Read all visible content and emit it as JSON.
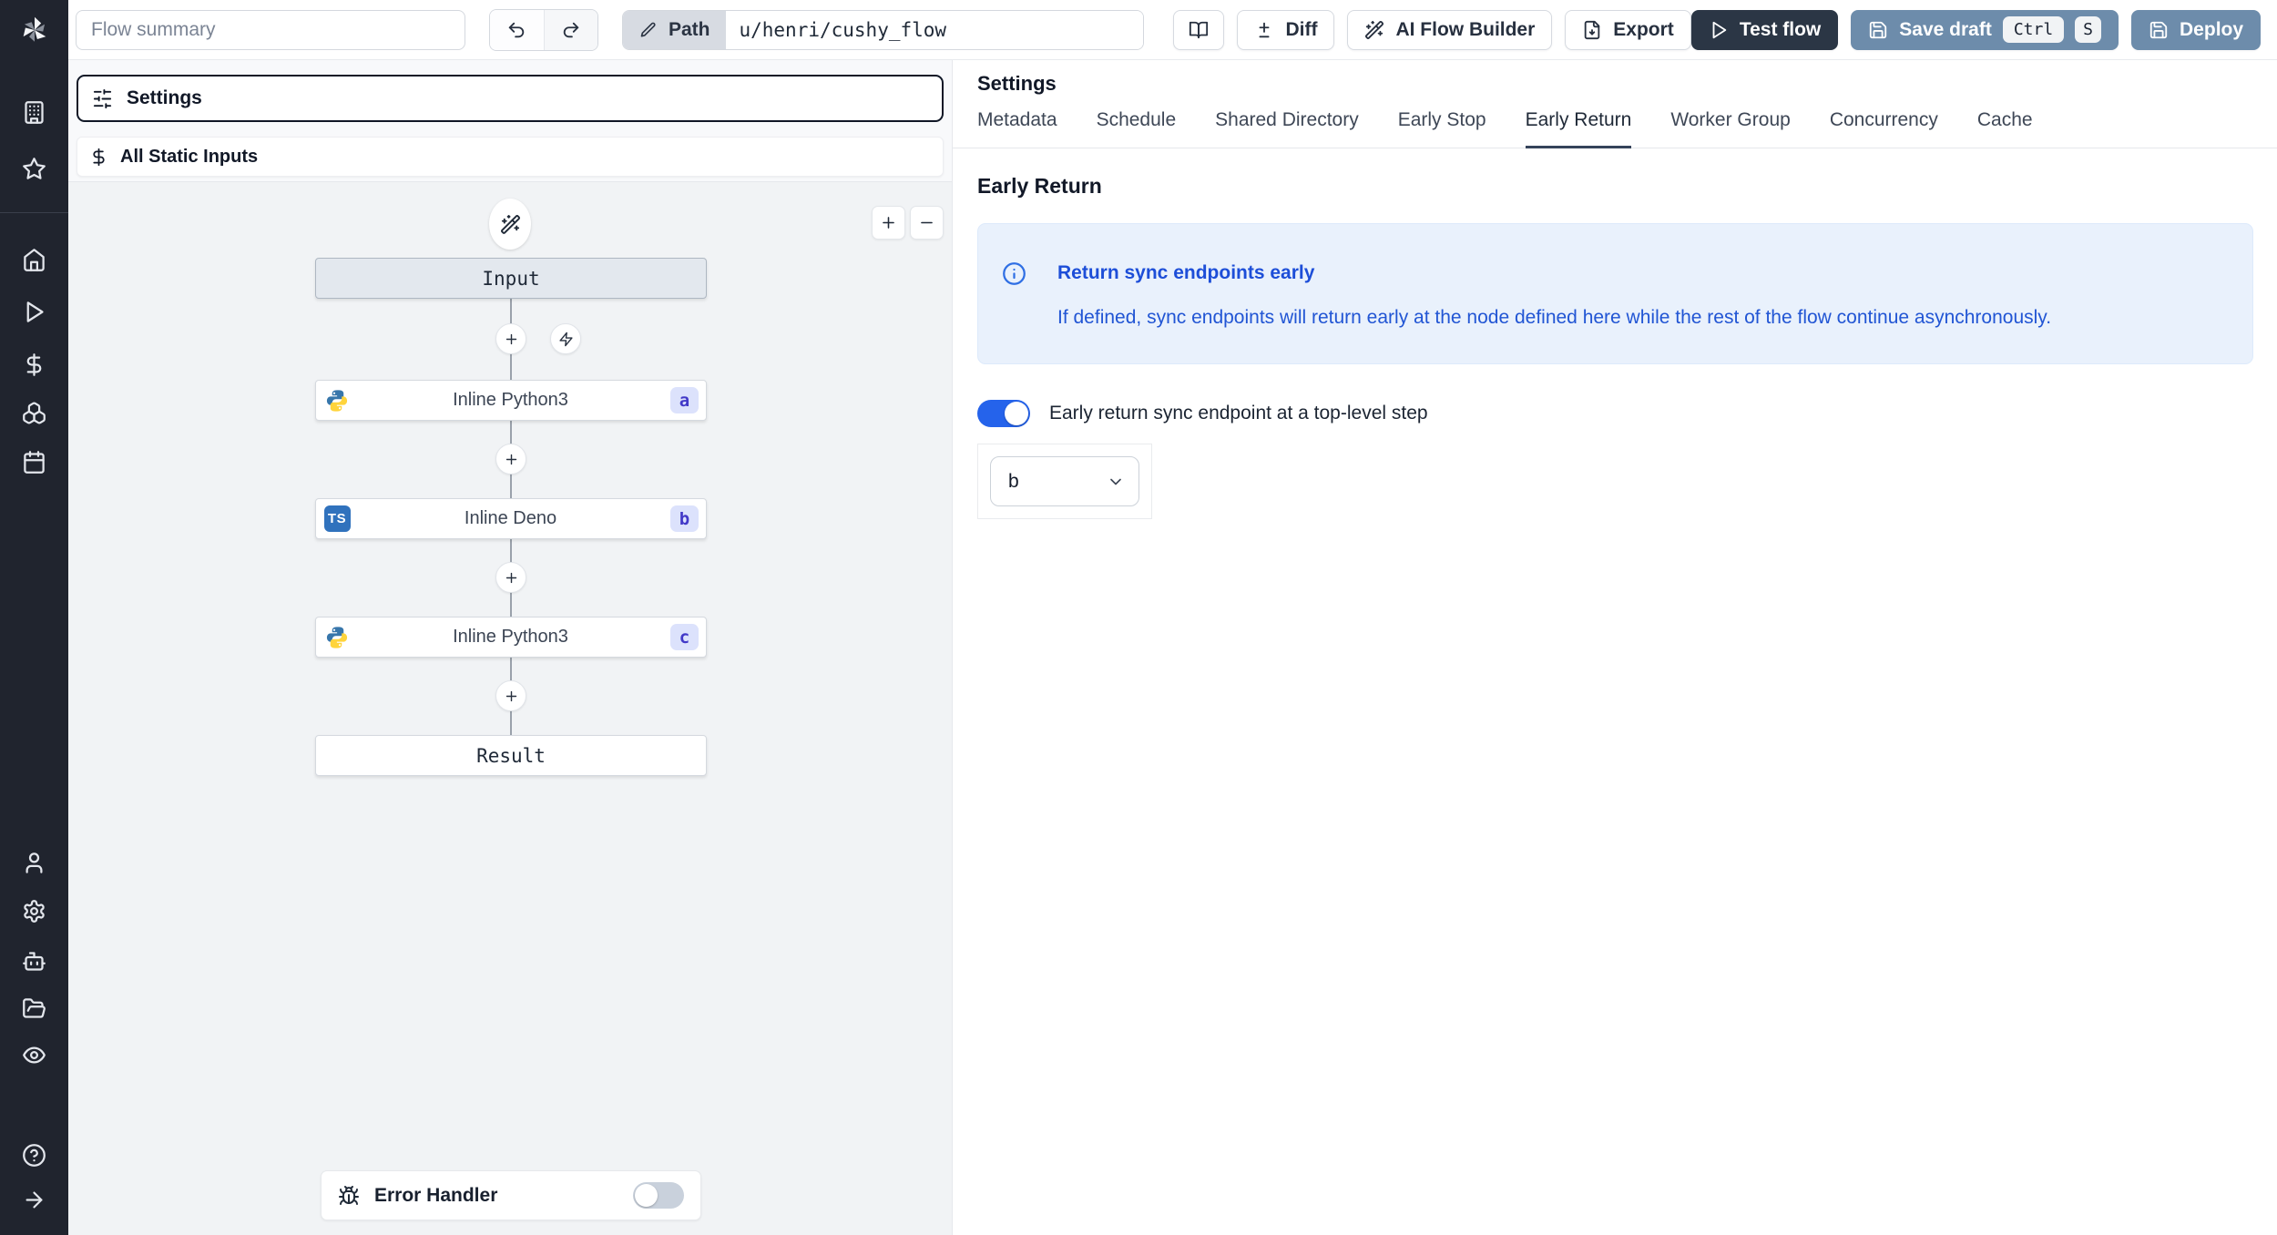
{
  "topbar": {
    "summary_placeholder": "Flow summary",
    "path_label": "Path",
    "path_value": "u/henri/cushy_flow",
    "diff_label": "Diff",
    "ai_flow_builder_label": "AI Flow Builder",
    "export_label": "Export",
    "test_flow_label": "Test flow",
    "save_draft_label": "Save draft",
    "save_shortcut_ctrl": "Ctrl",
    "save_shortcut_key": "S",
    "deploy_label": "Deploy"
  },
  "flow_panel": {
    "settings_label": "Settings",
    "all_static_inputs_label": "All Static Inputs",
    "zoom_in_label": "+",
    "zoom_out_label": "-",
    "input_node_label": "Input",
    "steps": [
      {
        "title": "Inline Python3",
        "badge": "a",
        "language": "python"
      },
      {
        "title": "Inline Deno",
        "badge": "b",
        "language": "typescript"
      },
      {
        "title": "Inline Python3",
        "badge": "c",
        "language": "python"
      }
    ],
    "ts_tile_label": "TS",
    "result_node_label": "Result",
    "error_handler_label": "Error Handler",
    "error_handler_enabled": false
  },
  "settings_panel": {
    "title": "Settings",
    "tabs": [
      "Metadata",
      "Schedule",
      "Shared Directory",
      "Early Stop",
      "Early Return",
      "Worker Group",
      "Concurrency",
      "Cache"
    ],
    "active_tab": "Early Return",
    "heading": "Early Return",
    "info_title": "Return sync endpoints early",
    "info_body": "If defined, sync endpoints will return early at the node defined here while the rest of the flow continue asynchronously.",
    "toggle_label": "Early return sync endpoint at a top-level step",
    "toggle_on": true,
    "selected_step": "b"
  },
  "colors": {
    "sidebar_bg": "#20242e",
    "accent_blue": "#2563eb",
    "steel_button": "#6d8cab",
    "dark_button": "#2b3645",
    "canvas_bg": "#f1f3f5",
    "badge_bg": "#dce2fc",
    "badge_text": "#4239c8",
    "info_bg": "#e9f1fc",
    "info_text": "#1d4ed8",
    "tab_underline": "#35435a"
  }
}
